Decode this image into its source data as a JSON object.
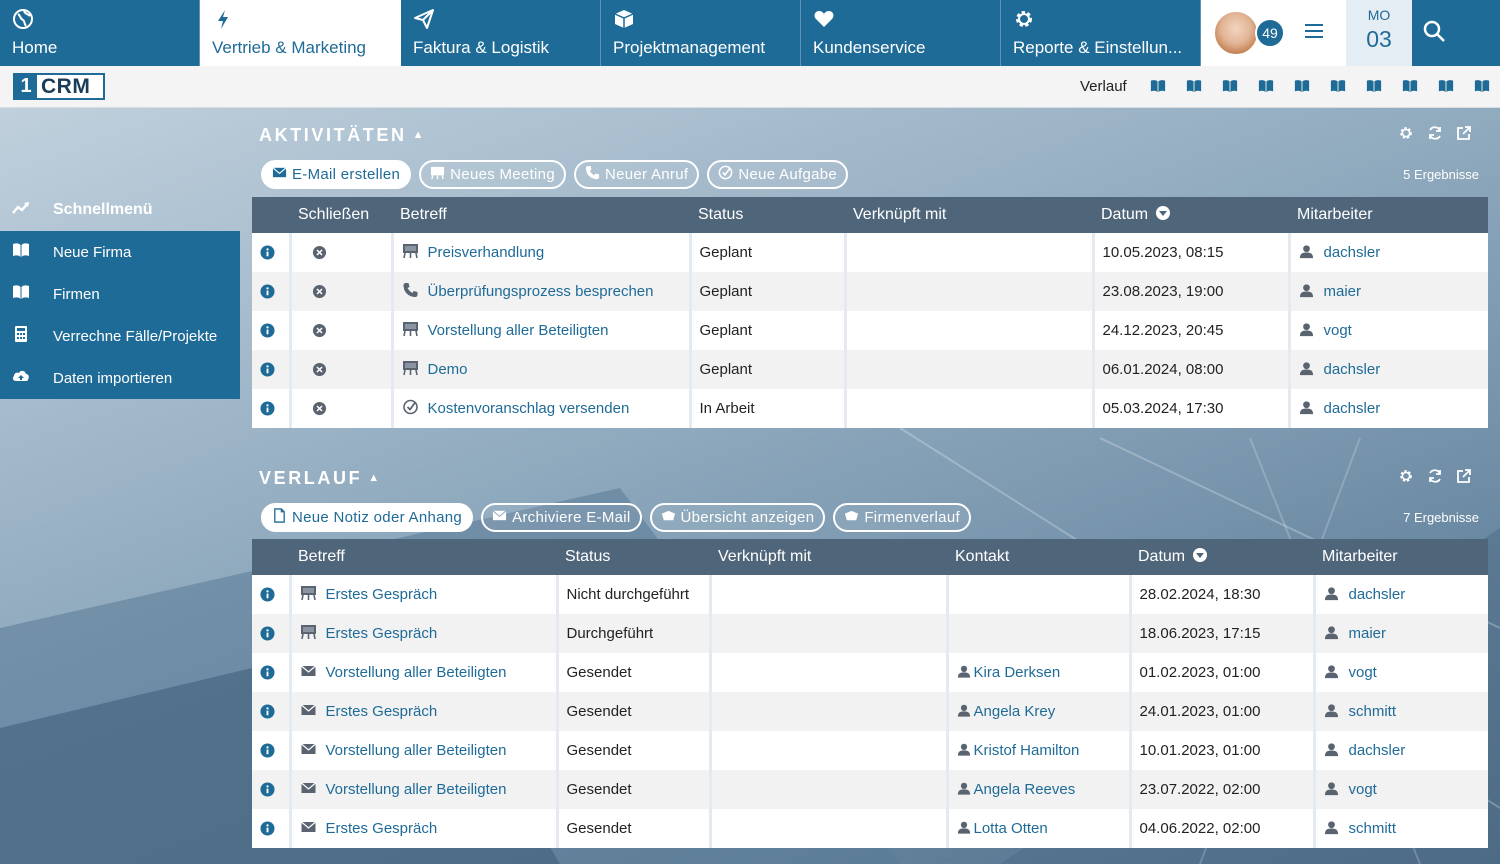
{
  "nav": {
    "tabs": [
      {
        "label": "Home",
        "icon": "globe-icon"
      },
      {
        "label": "Vertrieb & Marketing",
        "icon": "bolt-icon",
        "active": true
      },
      {
        "label": "Faktura & Logistik",
        "icon": "paper-plane-icon"
      },
      {
        "label": "Projektmanagement",
        "icon": "cube-icon"
      },
      {
        "label": "Kundenservice",
        "icon": "heart-icon"
      },
      {
        "label": "Reporte & Einstellun...",
        "icon": "gear-icon"
      }
    ],
    "notification_count": "49",
    "date_day": "MO",
    "date_num": "03"
  },
  "subbar": {
    "logo_one": "1",
    "logo_crm": "CRM",
    "history_label": "Verlauf",
    "bookmark_count": 10
  },
  "sidebar": {
    "heading": "Schnellmenü",
    "items": [
      {
        "label": "Neue Firma",
        "icon": "book-icon"
      },
      {
        "label": "Firmen",
        "icon": "book-icon"
      },
      {
        "label": "Verrechne Fälle/Projekte",
        "icon": "calculator-icon"
      },
      {
        "label": "Daten importieren",
        "icon": "cloud-upload-icon"
      }
    ]
  },
  "activities": {
    "title": "AKTIVITÄTEN",
    "buttons": [
      {
        "label": "E-Mail erstellen",
        "icon": "envelope-icon"
      },
      {
        "label": "Neues Meeting",
        "icon": "meeting-board-icon"
      },
      {
        "label": "Neuer Anruf",
        "icon": "phone-icon"
      },
      {
        "label": "Neue Aufgabe",
        "icon": "check-circle-icon"
      }
    ],
    "results": "5 Ergebnisse",
    "columns": {
      "close": "Schließen",
      "subject": "Betreff",
      "status": "Status",
      "linked": "Verknüpft mit",
      "date": "Datum",
      "employee": "Mitarbeiter"
    },
    "rows": [
      {
        "type": "meeting",
        "subject": "Preisverhandlung",
        "status": "Geplant",
        "linked": "",
        "date": "10.05.2023, 08:15",
        "user": "dachsler"
      },
      {
        "type": "call",
        "subject": "Überprüfungsprozess besprechen",
        "status": "Geplant",
        "linked": "",
        "date": "23.08.2023, 19:00",
        "user": "maier"
      },
      {
        "type": "meeting",
        "subject": "Vorstellung aller Beteiligten",
        "status": "Geplant",
        "linked": "",
        "date": "24.12.2023, 20:45",
        "user": "vogt"
      },
      {
        "type": "meeting",
        "subject": "Demo",
        "status": "Geplant",
        "linked": "",
        "date": "06.01.2024, 08:00",
        "user": "dachsler"
      },
      {
        "type": "task",
        "subject": "Kostenvoranschlag versenden",
        "status": "In Arbeit",
        "linked": "",
        "date": "05.03.2024, 17:30",
        "user": "dachsler"
      }
    ]
  },
  "history": {
    "title": "VERLAUF",
    "buttons": [
      {
        "label": "Neue Notiz oder Anhang",
        "icon": "document-icon"
      },
      {
        "label": "Archiviere E-Mail",
        "icon": "envelope-icon"
      },
      {
        "label": "Übersicht anzeigen",
        "icon": "cloud-icon"
      },
      {
        "label": "Firmenverlauf",
        "icon": "cloud-icon"
      }
    ],
    "results": "7 Ergebnisse",
    "columns": {
      "subject": "Betreff",
      "status": "Status",
      "linked": "Verknüpft mit",
      "contact": "Kontakt",
      "date": "Datum",
      "employee": "Mitarbeiter"
    },
    "rows": [
      {
        "type": "meeting",
        "subject": "Erstes Gespräch",
        "status": "Nicht durchgeführt",
        "linked": "",
        "contact": "",
        "date": "28.02.2024, 18:30",
        "user": "dachsler"
      },
      {
        "type": "meeting",
        "subject": "Erstes Gespräch",
        "status": "Durchgeführt",
        "linked": "",
        "contact": "",
        "date": "18.06.2023, 17:15",
        "user": "maier"
      },
      {
        "type": "email",
        "subject": "Vorstellung aller Beteiligten",
        "status": "Gesendet",
        "linked": "",
        "contact": "Kira Derksen",
        "date": "01.02.2023, 01:00",
        "user": "vogt"
      },
      {
        "type": "email",
        "subject": "Erstes Gespräch",
        "status": "Gesendet",
        "linked": "",
        "contact": "Angela Krey",
        "date": "24.01.2023, 01:00",
        "user": "schmitt"
      },
      {
        "type": "email",
        "subject": "Vorstellung aller Beteiligten",
        "status": "Gesendet",
        "linked": "",
        "contact": "Kristof Hamilton",
        "date": "10.01.2023, 01:00",
        "user": "dachsler"
      },
      {
        "type": "email",
        "subject": "Vorstellung aller Beteiligten",
        "status": "Gesendet",
        "linked": "",
        "contact": "Angela Reeves",
        "date": "23.07.2022, 02:00",
        "user": "vogt"
      },
      {
        "type": "email",
        "subject": "Erstes Gespräch",
        "status": "Gesendet",
        "linked": "",
        "contact": "Lotta Otten",
        "date": "04.06.2022, 02:00",
        "user": "schmitt"
      }
    ]
  },
  "colors": {
    "primary": "#1f6b97",
    "header_row": "#4f657a",
    "link": "#1f6b97"
  }
}
